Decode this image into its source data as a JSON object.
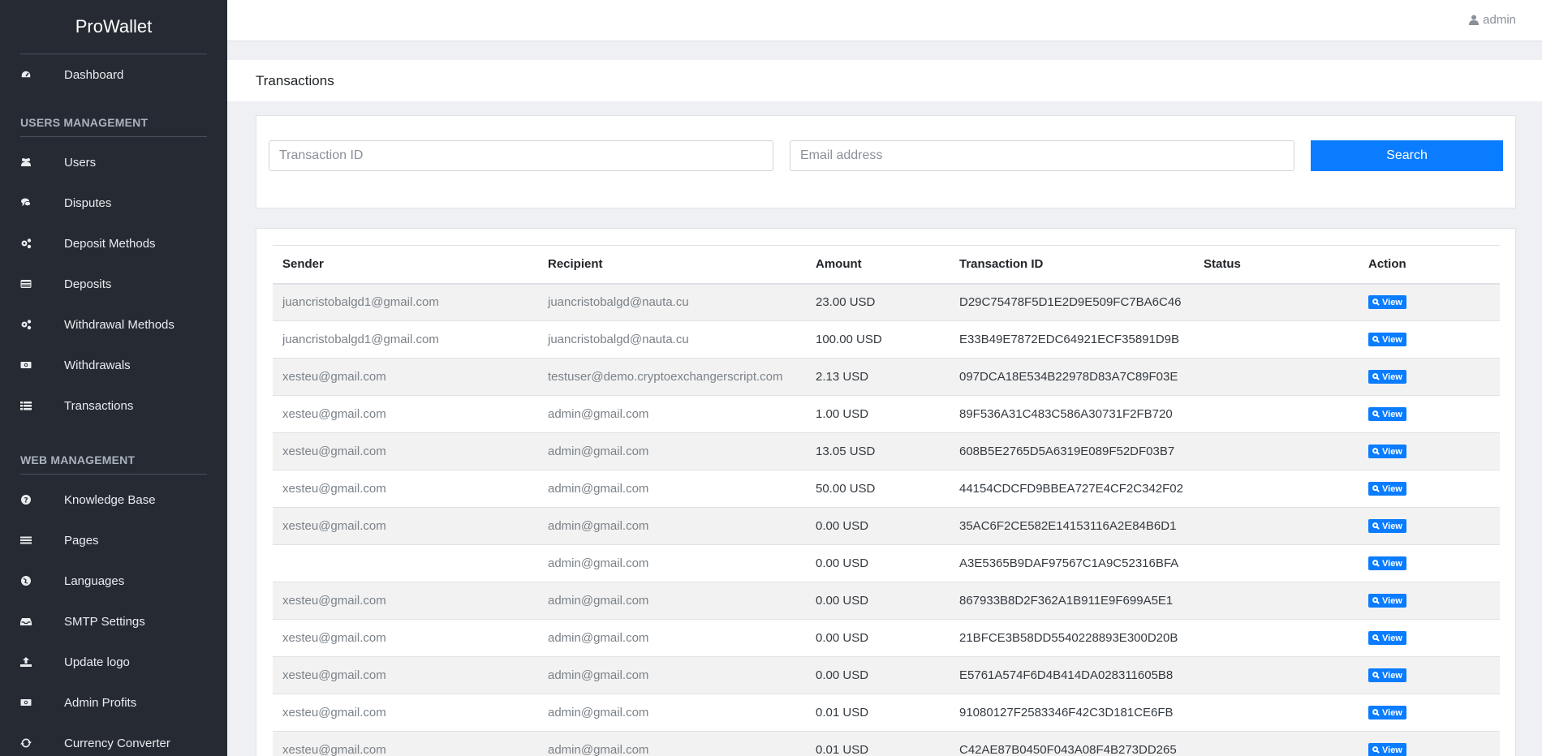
{
  "app": {
    "brand": "ProWallet"
  },
  "topbar": {
    "user": "admin"
  },
  "sidebar": {
    "top_items": [
      {
        "label": "Dashboard",
        "icon": "dashboard-icon"
      }
    ],
    "sections": [
      {
        "title": "USERS MANAGEMENT",
        "items": [
          {
            "label": "Users",
            "icon": "users-icon"
          },
          {
            "label": "Disputes",
            "icon": "comments-icon"
          },
          {
            "label": "Deposit Methods",
            "icon": "cogs-icon"
          },
          {
            "label": "Deposits",
            "icon": "credit-card-icon"
          },
          {
            "label": "Withdrawal Methods",
            "icon": "cogs-icon"
          },
          {
            "label": "Withdrawals",
            "icon": "money-icon"
          },
          {
            "label": "Transactions",
            "icon": "list-icon"
          }
        ]
      },
      {
        "title": "WEB MANAGEMENT",
        "items": [
          {
            "label": "Knowledge Base",
            "icon": "question-circle-icon"
          },
          {
            "label": "Pages",
            "icon": "bars-icon"
          },
          {
            "label": "Languages",
            "icon": "globe-icon"
          },
          {
            "label": "SMTP Settings",
            "icon": "inbox-icon"
          },
          {
            "label": "Update logo",
            "icon": "upload-icon"
          },
          {
            "label": "Admin Profits",
            "icon": "money-icon"
          },
          {
            "label": "Currency Converter",
            "icon": "refresh-icon"
          }
        ]
      }
    ]
  },
  "page": {
    "title": "Transactions"
  },
  "search": {
    "transaction_id_placeholder": "Transaction ID",
    "email_placeholder": "Email address",
    "button_label": "Search"
  },
  "table": {
    "headers": [
      "Sender",
      "Recipient",
      "Amount",
      "Transaction ID",
      "Status",
      "Action"
    ],
    "action_label": "View",
    "rows": [
      {
        "sender": "juancristobalgd1@gmail.com",
        "recipient": "juancristobalgd@nauta.cu",
        "amount": "23.00 USD",
        "txid": "D29C75478F5D1E2D9E509FC7BA6C46",
        "status": ""
      },
      {
        "sender": "juancristobalgd1@gmail.com",
        "recipient": "juancristobalgd@nauta.cu",
        "amount": "100.00 USD",
        "txid": "E33B49E7872EDC64921ECF35891D9B",
        "status": ""
      },
      {
        "sender": "xesteu@gmail.com",
        "recipient": "testuser@demo.cryptoexchangerscript.com",
        "amount": "2.13 USD",
        "txid": "097DCA18E534B22978D83A7C89F03E",
        "status": ""
      },
      {
        "sender": "xesteu@gmail.com",
        "recipient": "admin@gmail.com",
        "amount": "1.00 USD",
        "txid": "89F536A31C483C586A30731F2FB720",
        "status": ""
      },
      {
        "sender": "xesteu@gmail.com",
        "recipient": "admin@gmail.com",
        "amount": "13.05 USD",
        "txid": "608B5E2765D5A6319E089F52DF03B7",
        "status": ""
      },
      {
        "sender": "xesteu@gmail.com",
        "recipient": "admin@gmail.com",
        "amount": "50.00 USD",
        "txid": "44154CDCFD9BBEA727E4CF2C342F02",
        "status": ""
      },
      {
        "sender": "xesteu@gmail.com",
        "recipient": "admin@gmail.com",
        "amount": "0.00 USD",
        "txid": "35AC6F2CE582E14153116A2E84B6D1",
        "status": ""
      },
      {
        "sender": "",
        "recipient": "admin@gmail.com",
        "amount": "0.00 USD",
        "txid": "A3E5365B9DAF97567C1A9C52316BFA",
        "status": ""
      },
      {
        "sender": "xesteu@gmail.com",
        "recipient": "admin@gmail.com",
        "amount": "0.00 USD",
        "txid": "867933B8D2F362A1B911E9F699A5E1",
        "status": ""
      },
      {
        "sender": "xesteu@gmail.com",
        "recipient": "admin@gmail.com",
        "amount": "0.00 USD",
        "txid": "21BFCE3B58DD5540228893E300D20B",
        "status": ""
      },
      {
        "sender": "xesteu@gmail.com",
        "recipient": "admin@gmail.com",
        "amount": "0.00 USD",
        "txid": "E5761A574F6D4B414DA028311605B8",
        "status": ""
      },
      {
        "sender": "xesteu@gmail.com",
        "recipient": "admin@gmail.com",
        "amount": "0.01 USD",
        "txid": "91080127F2583346F42C3D181CE6FB",
        "status": ""
      },
      {
        "sender": "xesteu@gmail.com",
        "recipient": "admin@gmail.com",
        "amount": "0.01 USD",
        "txid": "C42AE87B0450F043A08F4B273DD265",
        "status": ""
      }
    ]
  },
  "colors": {
    "primary": "#0a7cff",
    "sidebar_bg": "#262b33"
  }
}
